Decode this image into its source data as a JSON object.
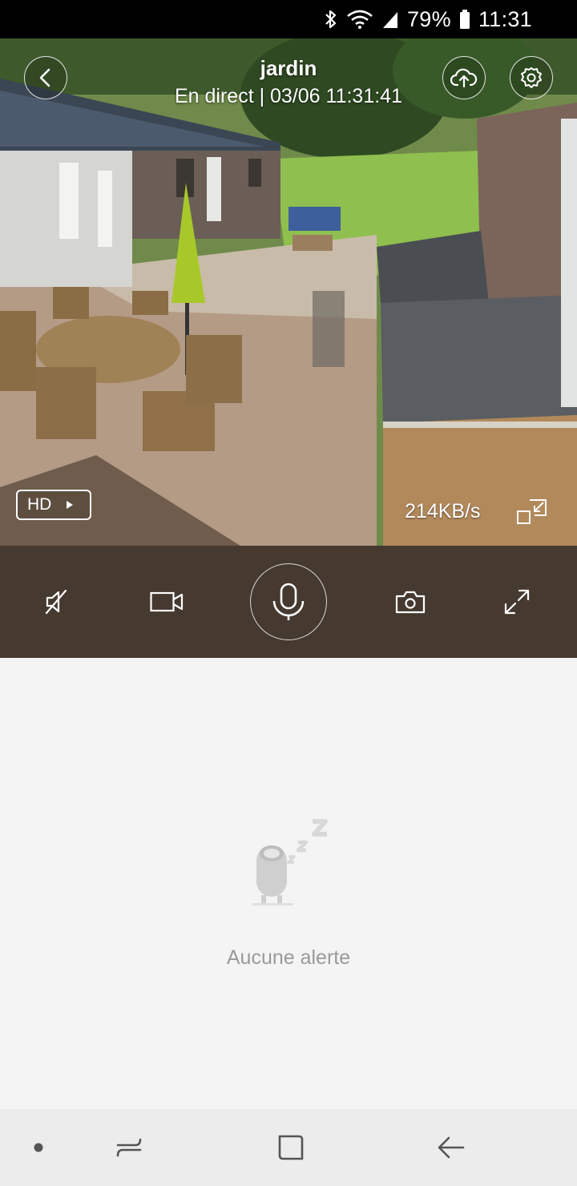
{
  "status_bar": {
    "battery_percent": "79%",
    "time": "11:31",
    "icons": [
      "bluetooth-icon",
      "wifi-icon",
      "signal-icon",
      "battery-icon"
    ]
  },
  "camera": {
    "title": "jardin",
    "subtitle": "En direct | 03/06 11:31:41",
    "quality_label": "HD",
    "data_rate": "214KB/s",
    "icons": {
      "back": "back-arrow-icon",
      "cloud": "cloud-upload-icon",
      "settings": "gear-icon",
      "shrink": "shrink-window-icon"
    }
  },
  "controls": {
    "items": [
      "mute-icon",
      "video-record-icon",
      "microphone-icon",
      "camera-snapshot-icon",
      "fullscreen-icon"
    ]
  },
  "alerts": {
    "empty_text": "Aucune alerte"
  },
  "nav_bar": {
    "icons": [
      "nav-dot-icon",
      "recents-icon",
      "home-icon",
      "back-icon"
    ]
  },
  "colors": {
    "control_bar": "#46392f",
    "empty_background": "#f4f4f4",
    "empty_text": "#9a9a9a"
  }
}
